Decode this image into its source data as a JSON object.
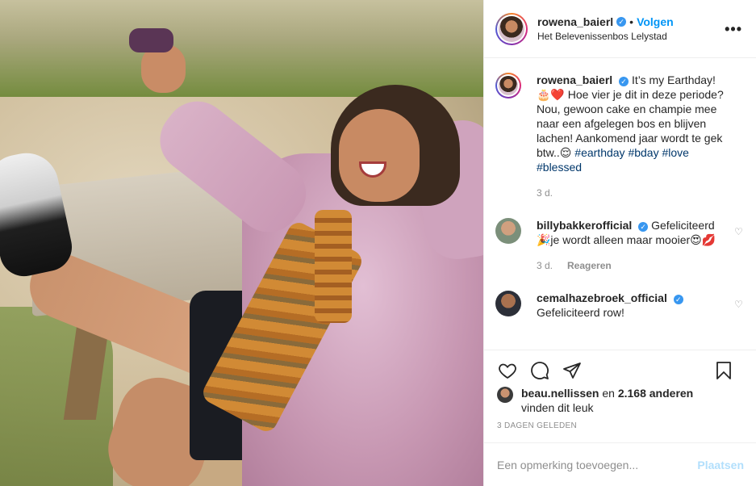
{
  "photo": {
    "alt_subject": "woman-in-pink-coat-photo"
  },
  "header": {
    "username": "rowena_baierl",
    "verified_glyph": "✓",
    "separator": "•",
    "follow_label": "Volgen",
    "location": "Het Belevenissenbos Lelystad",
    "more_glyph": "•••"
  },
  "caption": {
    "username": "rowena_baierl",
    "text": "It’s my Earthday! 🎂❤️ Hoe vier je dit in deze periode? Nou, gewoon cake en champie mee naar een afgelegen bos en blijven lachen! Aankomend jaar wordt te gek btw..😌",
    "hashtags": "#earthday #bday #love #blessed",
    "time": "3 d."
  },
  "comments": [
    {
      "username": "billybakkerofficial",
      "text": "Gefeliciteerd 🎉je wordt alleen maar mooier😍💋",
      "time": "3 d.",
      "reply_label": "Reageren"
    },
    {
      "username": "cemalhazebroek_official",
      "text": "Gefeliciteerd row!"
    }
  ],
  "likes": {
    "first_user": "beau.nellissen",
    "connector": "en",
    "others_count": "2.168 anderen",
    "suffix": "vinden dit leuk"
  },
  "post_date": "3 DAGEN GELEDEN",
  "add_comment": {
    "placeholder": "Een opmerking toevoegen...",
    "post_label": "Plaatsen"
  },
  "colors": {
    "link_blue": "#0095f6",
    "verified_blue": "#3897f0",
    "hashtag": "#00376b",
    "muted": "#8e8e8e",
    "post_disabled": "#b2dffc"
  },
  "icons": [
    "heart-icon",
    "comment-icon",
    "share-icon",
    "bookmark-icon",
    "more-icon",
    "verified-icon",
    "heart-small-icon"
  ]
}
